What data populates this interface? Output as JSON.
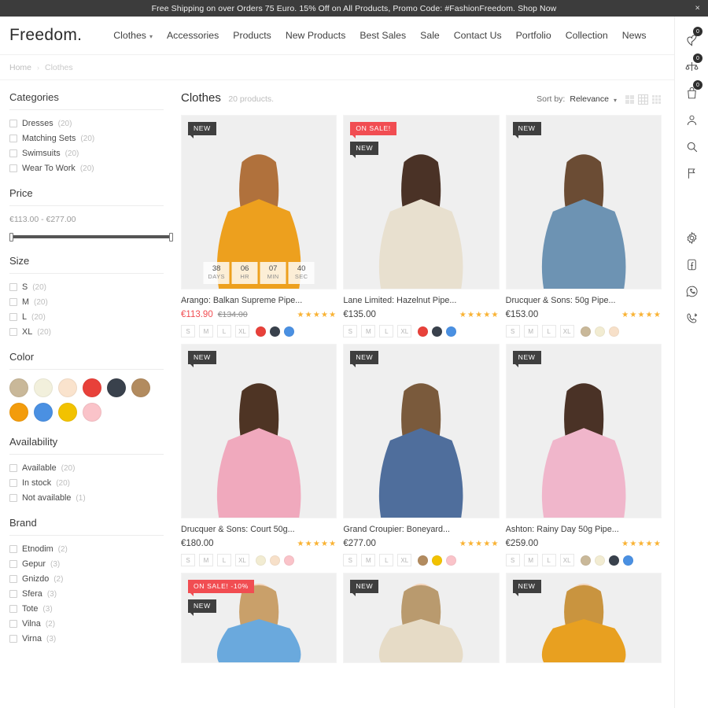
{
  "promo": {
    "text": "Free Shipping on over Orders 75 Euro. 15% Off on All Products, Promo Code: #FashionFreedom. Shop Now",
    "close_label": "×"
  },
  "header": {
    "logo": "Freedom.",
    "nav": [
      {
        "label": "Clothes",
        "has_caret": true
      },
      {
        "label": "Accessories",
        "has_caret": false
      },
      {
        "label": "Products",
        "has_caret": false
      },
      {
        "label": "New Products",
        "has_caret": false
      },
      {
        "label": "Best Sales",
        "has_caret": false
      },
      {
        "label": "Sale",
        "has_caret": false
      },
      {
        "label": "Contact Us",
        "has_caret": false
      },
      {
        "label": "Portfolio",
        "has_caret": false
      },
      {
        "label": "Collection",
        "has_caret": false
      },
      {
        "label": "News",
        "has_caret": false
      }
    ],
    "caret": "▾"
  },
  "breadcrumb": {
    "home": "Home",
    "sep": "›",
    "current": "Clothes"
  },
  "sidebar": {
    "categories": {
      "title": "Categories",
      "items": [
        {
          "label": "Dresses",
          "count": "(20)"
        },
        {
          "label": "Matching Sets",
          "count": "(20)"
        },
        {
          "label": "Swimsuits",
          "count": "(20)"
        },
        {
          "label": "Wear To Work",
          "count": "(20)"
        }
      ]
    },
    "price": {
      "title": "Price",
      "range_text": "€113.00 - €277.00"
    },
    "size": {
      "title": "Size",
      "items": [
        {
          "label": "S",
          "count": "(20)"
        },
        {
          "label": "M",
          "count": "(20)"
        },
        {
          "label": "L",
          "count": "(20)"
        },
        {
          "label": "XL",
          "count": "(20)"
        }
      ]
    },
    "color": {
      "title": "Color",
      "swatches": [
        "#c9b899",
        "#f2f0dc",
        "#fae3cd",
        "#e8413a",
        "#39414c",
        "#b28b5f",
        "#f39c0c",
        "#4a90e2",
        "#f2c200",
        "#fac3c9"
      ]
    },
    "availability": {
      "title": "Availability",
      "items": [
        {
          "label": "Available",
          "count": "(20)"
        },
        {
          "label": "In stock",
          "count": "(20)"
        },
        {
          "label": "Not available",
          "count": "(1)"
        }
      ]
    },
    "brand": {
      "title": "Brand",
      "items": [
        {
          "label": "Etnodim",
          "count": "(2)"
        },
        {
          "label": "Gepur",
          "count": "(3)"
        },
        {
          "label": "Gnizdo",
          "count": "(2)"
        },
        {
          "label": "Sfera",
          "count": "(3)"
        },
        {
          "label": "Tote",
          "count": "(3)"
        },
        {
          "label": "Vilna",
          "count": "(2)"
        },
        {
          "label": "Virna",
          "count": "(3)"
        }
      ]
    }
  },
  "content": {
    "category_title": "Clothes",
    "product_count": "20 products.",
    "sort_label": "Sort by:",
    "sort_value": "Relevance",
    "sort_caret": "▾",
    "view_modes": [
      "grid-2-icon",
      "grid-3-icon",
      "grid-4-icon"
    ],
    "active_view": 1
  },
  "products": [
    {
      "name": "Arango: Balkan Supreme Pipe...",
      "price": "€113.90",
      "old_price": "€134.00",
      "on_sale": true,
      "stars": "★★★★★",
      "badges": [
        {
          "type": "new",
          "label": "NEW"
        }
      ],
      "sizes": [
        "S",
        "M",
        "L",
        "XL"
      ],
      "colors": [
        "#e8413a",
        "#39414c",
        "#4a90e2"
      ],
      "countdown": [
        {
          "num": "38",
          "label": "DAYS"
        },
        {
          "num": "06",
          "label": "HR"
        },
        {
          "num": "07",
          "label": "MIN"
        },
        {
          "num": "40",
          "label": "SEC"
        }
      ],
      "photo": {
        "bg": "#efefef",
        "garment": "#eda01e",
        "hair": "#b0713c",
        "skin": "#f3d4bb"
      }
    },
    {
      "name": "Lane Limited: Hazelnut Pipe...",
      "price": "€135.00",
      "old_price": "",
      "on_sale": false,
      "stars": "★★★★★",
      "badges": [
        {
          "type": "sale",
          "label": "ON SALE!"
        },
        {
          "type": "new",
          "label": "NEW"
        }
      ],
      "sizes": [
        "S",
        "M",
        "L",
        "XL"
      ],
      "colors": [
        "#e8413a",
        "#39414c",
        "#4a90e2"
      ],
      "countdown": [],
      "photo": {
        "bg": "#efefef",
        "garment": "#e8e0cf",
        "hair": "#4a3226",
        "skin": "#f3d4bb"
      }
    },
    {
      "name": "Drucquer & Sons: 50g Pipe...",
      "price": "€153.00",
      "old_price": "",
      "on_sale": false,
      "stars": "★★★★★",
      "badges": [
        {
          "type": "new",
          "label": "NEW"
        }
      ],
      "sizes": [
        "S",
        "M",
        "L",
        "XL"
      ],
      "colors": [
        "#c9b899",
        "#f2ecd2",
        "#f7e0c9"
      ],
      "countdown": [],
      "photo": {
        "bg": "#efefef",
        "garment": "#6d93b3",
        "hair": "#6b4c34",
        "skin": "#f3d4bb"
      }
    },
    {
      "name": "Drucquer & Sons: Court 50g...",
      "price": "€180.00",
      "old_price": "",
      "on_sale": false,
      "stars": "★★★★★",
      "badges": [
        {
          "type": "new",
          "label": "NEW"
        }
      ],
      "sizes": [
        "S",
        "M",
        "L",
        "XL"
      ],
      "colors": [
        "#f2ecd2",
        "#f7e0c9",
        "#fac3c9"
      ],
      "countdown": [],
      "photo": {
        "bg": "#efefef",
        "garment": "#f0a9bd",
        "hair": "#4e3424",
        "skin": "#f3d4bb"
      }
    },
    {
      "name": "Grand Croupier: Boneyard...",
      "price": "€277.00",
      "old_price": "",
      "on_sale": false,
      "stars": "★★★★★",
      "badges": [
        {
          "type": "new",
          "label": "NEW"
        }
      ],
      "sizes": [
        "S",
        "M",
        "L",
        "XL"
      ],
      "colors": [
        "#b28b5f",
        "#f2c200",
        "#fac3c9"
      ],
      "countdown": [],
      "photo": {
        "bg": "#efefef",
        "garment": "#4f6e9c",
        "hair": "#7a5a3c",
        "skin": "#f3d4bb"
      }
    },
    {
      "name": "Ashton: Rainy Day 50g Pipe...",
      "price": "€259.00",
      "old_price": "",
      "on_sale": false,
      "stars": "★★★★★",
      "badges": [
        {
          "type": "new",
          "label": "NEW"
        }
      ],
      "sizes": [
        "S",
        "M",
        "L",
        "XL"
      ],
      "colors": [
        "#c9b899",
        "#f2ecd2",
        "#39414c",
        "#4a90e2"
      ],
      "countdown": [],
      "photo": {
        "bg": "#efefef",
        "garment": "#f0b6cb",
        "hair": "#4a3226",
        "skin": "#f3d4bb"
      }
    },
    {
      "name": "",
      "price": "",
      "old_price": "",
      "on_sale": true,
      "stars": "",
      "badges": [
        {
          "type": "sale",
          "label": "ON SALE! -10%"
        },
        {
          "type": "new",
          "label": "NEW"
        }
      ],
      "sizes": [],
      "colors": [],
      "countdown": [],
      "photo": {
        "bg": "#efefef",
        "garment": "#6aa9dd",
        "hair": "#c9a06a",
        "skin": "#f3d4bb"
      }
    },
    {
      "name": "",
      "price": "",
      "old_price": "",
      "on_sale": false,
      "stars": "",
      "badges": [
        {
          "type": "new",
          "label": "NEW"
        }
      ],
      "sizes": [],
      "colors": [],
      "countdown": [],
      "photo": {
        "bg": "#efefef",
        "garment": "#e6dbc6",
        "hair": "#b99a6e",
        "skin": "#f3d4bb"
      }
    },
    {
      "name": "",
      "price": "",
      "old_price": "",
      "on_sale": false,
      "stars": "",
      "badges": [
        {
          "type": "new",
          "label": "NEW"
        }
      ],
      "sizes": [],
      "colors": [],
      "countdown": [],
      "photo": {
        "bg": "#efefef",
        "garment": "#e8a020",
        "hair": "#c9943f",
        "skin": "#f3d4bb"
      }
    }
  ],
  "rail": {
    "top_icons": [
      {
        "name": "wishlist-heart-icon",
        "badge": "0"
      },
      {
        "name": "compare-scales-icon",
        "badge": "0"
      },
      {
        "name": "cart-bag-icon",
        "badge": "0"
      },
      {
        "name": "account-user-icon",
        "badge": ""
      },
      {
        "name": "search-icon",
        "badge": ""
      },
      {
        "name": "flag-icon",
        "badge": ""
      }
    ],
    "bottom_icons": [
      {
        "name": "settings-gear-icon"
      },
      {
        "name": "facebook-icon"
      },
      {
        "name": "whatsapp-icon"
      },
      {
        "name": "phone-callback-icon"
      }
    ]
  }
}
